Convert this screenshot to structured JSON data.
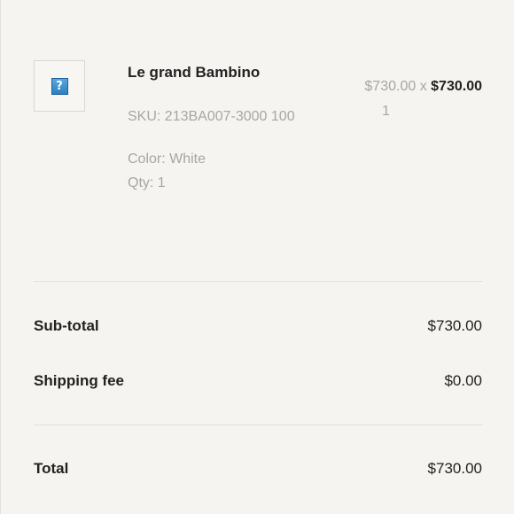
{
  "item": {
    "name": "Le grand Bambino",
    "sku": "SKU: 213BA007-3000 100",
    "color": "Color: White",
    "qty": "Qty: 1",
    "unit_price": "$730.00",
    "times": "x",
    "line_total": "$730.00",
    "quantity_number": "1",
    "image_icon": "broken-image-icon"
  },
  "summary": {
    "subtotal_label": "Sub-total",
    "subtotal_value": "$730.00",
    "shipping_label": "Shipping fee",
    "shipping_value": "$0.00",
    "total_label": "Total",
    "total_value": "$730.00"
  }
}
